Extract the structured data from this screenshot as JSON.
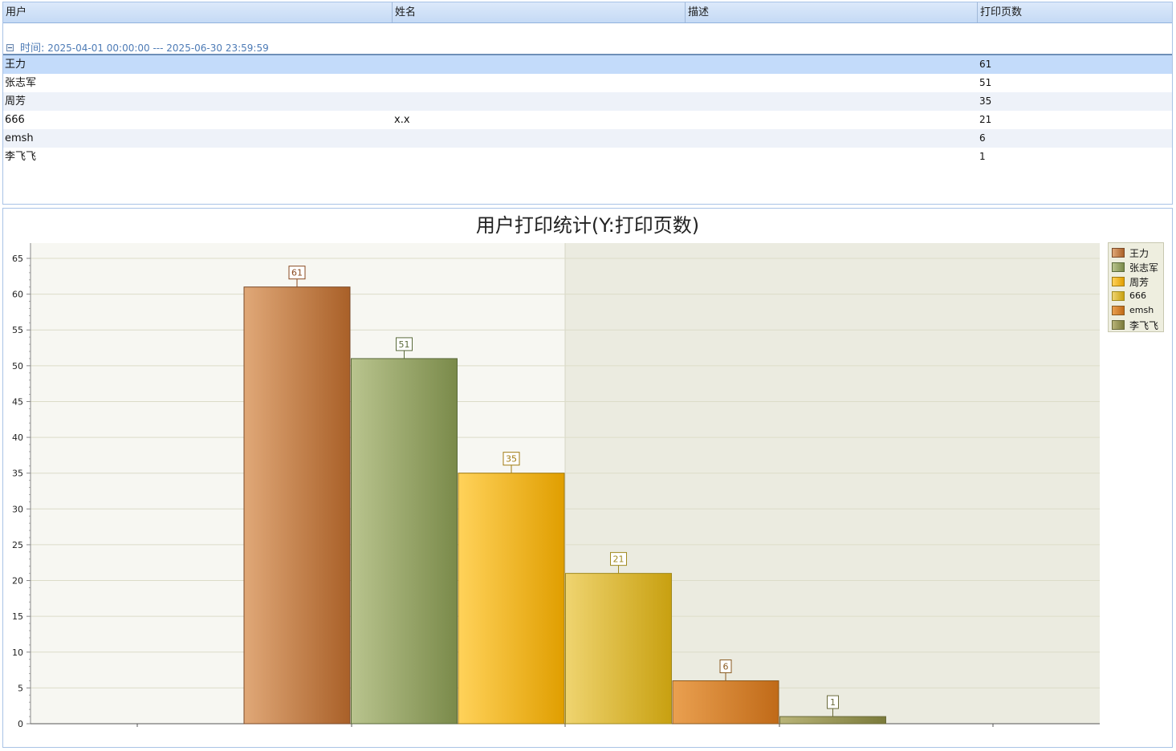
{
  "grid": {
    "columns": [
      "用户",
      "姓名",
      "描述",
      "打印页数"
    ],
    "group": {
      "label": "时间:",
      "range": "2025-04-01 00:00:00 --- 2025-06-30 23:59:59"
    },
    "rows": [
      {
        "user": "王力",
        "name": "",
        "desc": "",
        "pages": "61"
      },
      {
        "user": "张志军",
        "name": "",
        "desc": "",
        "pages": "51"
      },
      {
        "user": "周芳",
        "name": "",
        "desc": "",
        "pages": "35"
      },
      {
        "user": "666",
        "name": "x.x",
        "desc": "",
        "pages": "21"
      },
      {
        "user": "emsh",
        "name": "",
        "desc": "",
        "pages": "6"
      },
      {
        "user": "李飞飞",
        "name": "",
        "desc": "",
        "pages": "1"
      }
    ]
  },
  "chart_data": {
    "type": "bar",
    "title": "用户打印统计(Y:打印页数)",
    "categories": [
      "王力",
      "张志军",
      "周芳",
      "666",
      "emsh",
      "李飞飞"
    ],
    "values": [
      61,
      51,
      35,
      21,
      6,
      1
    ],
    "ylim": [
      0,
      65
    ],
    "yticks": [
      "0",
      "5",
      "10",
      "15",
      "20",
      "25",
      "30",
      "35",
      "40",
      "45",
      "50",
      "55",
      "60",
      "65"
    ],
    "grid": true,
    "legend_position": "top-right",
    "colors": [
      [
        "#e0a878",
        "#a96028",
        "#7a4a28"
      ],
      [
        "#b9c48e",
        "#7a8a4a",
        "#5a6a3a"
      ],
      [
        "#ffd25a",
        "#e09e00",
        "#a07a10"
      ],
      [
        "#efd470",
        "#c8a010",
        "#a08a20"
      ],
      [
        "#eaa050",
        "#c06a18",
        "#8a5a20"
      ],
      [
        "#b9b478",
        "#7a7a3a",
        "#6a6a3a"
      ]
    ],
    "label_colors": [
      "#8a4a20",
      "#5a6a3a",
      "#a07a10",
      "#a08a20",
      "#8a5a20",
      "#6a6a3a"
    ]
  }
}
